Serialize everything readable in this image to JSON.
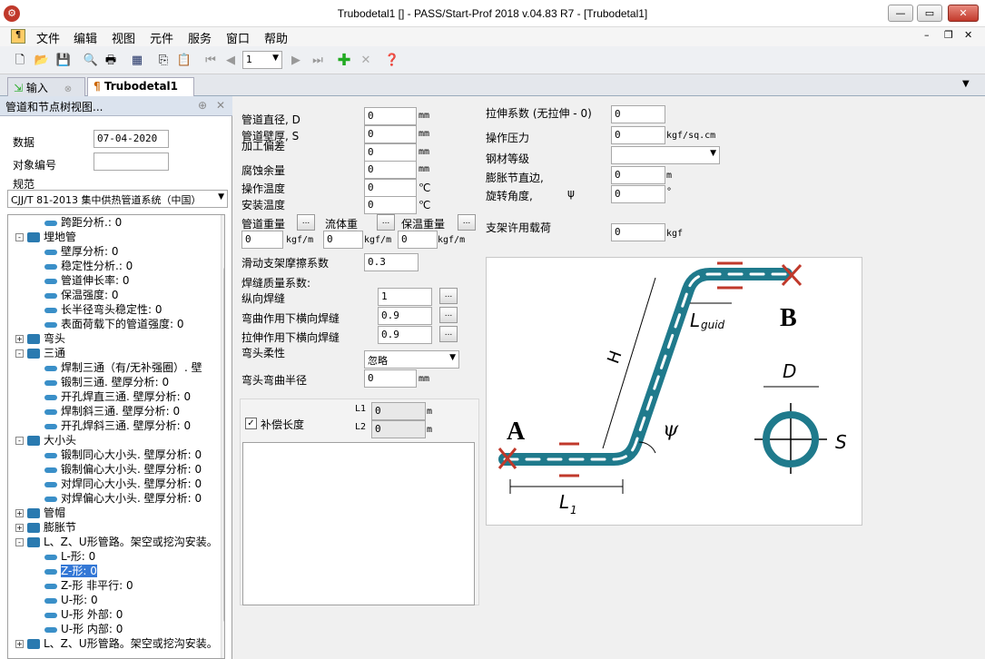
{
  "window": {
    "title": "Trubodetal1 [] - PASS/Start-Prof 2018 v.04.83 R7 - [Trubodetal1]"
  },
  "menu": [
    "文件",
    "编辑",
    "视图",
    "元件",
    "服务",
    "窗口",
    "帮助"
  ],
  "toolbar": {
    "page_value": "1"
  },
  "tabs": [
    {
      "label": "输入"
    },
    {
      "label": "Trubodetal1"
    }
  ],
  "left": {
    "panel_title": "管道和节点树视图...",
    "date_label": "数据",
    "date_value": "07-04-2020",
    "object_label": "对象编号",
    "object_value": "",
    "norm_label": "规范",
    "norm_value": "CJJ/T 81-2013 集中供热管道系统（中国）"
  },
  "tree": [
    {
      "label": "跨距分析.: 0",
      "indent": 2
    },
    {
      "label": "埋地管",
      "indent": 1,
      "exp": "-"
    },
    {
      "label": "壁厚分析: 0",
      "indent": 2
    },
    {
      "label": "稳定性分析.: 0",
      "indent": 2
    },
    {
      "label": "管道伸长率: 0",
      "indent": 2
    },
    {
      "label": "保温强度: 0",
      "indent": 2
    },
    {
      "label": "长半径弯头稳定性: 0",
      "indent": 2
    },
    {
      "label": "表面荷载下的管道强度: 0",
      "indent": 2
    },
    {
      "label": "弯头",
      "indent": 1,
      "exp": "+"
    },
    {
      "label": "三通",
      "indent": 1,
      "exp": "-"
    },
    {
      "label": "焊制三通（有/无补强圈）. 壁",
      "indent": 2
    },
    {
      "label": "锻制三通. 壁厚分析: 0",
      "indent": 2
    },
    {
      "label": "开孔焊直三通. 壁厚分析: 0",
      "indent": 2
    },
    {
      "label": "焊制斜三通. 壁厚分析: 0",
      "indent": 2
    },
    {
      "label": "开孔焊斜三通. 壁厚分析: 0",
      "indent": 2
    },
    {
      "label": "大小头",
      "indent": 1,
      "exp": "-"
    },
    {
      "label": "锻制同心大小头. 壁厚分析: 0",
      "indent": 2
    },
    {
      "label": "锻制偏心大小头. 壁厚分析: 0",
      "indent": 2
    },
    {
      "label": "对焊同心大小头. 壁厚分析: 0",
      "indent": 2
    },
    {
      "label": "对焊偏心大小头. 壁厚分析: 0",
      "indent": 2
    },
    {
      "label": "管帽",
      "indent": 1,
      "exp": "+"
    },
    {
      "label": "膨胀节",
      "indent": 1,
      "exp": "+"
    },
    {
      "label": "L、Z、U形管路。架空或挖沟安装。",
      "indent": 1,
      "exp": "-"
    },
    {
      "label": "L-形: 0",
      "indent": 2
    },
    {
      "label": "Z-形: 0",
      "indent": 2,
      "selected": true
    },
    {
      "label": "Z-形 非平行: 0",
      "indent": 2
    },
    {
      "label": "U-形: 0",
      "indent": 2
    },
    {
      "label": "U-形 外部: 0",
      "indent": 2
    },
    {
      "label": "U-形 内部: 0",
      "indent": 2
    },
    {
      "label": "L、Z、U形管路。架空或挖沟安装。",
      "indent": 1,
      "exp": "+"
    }
  ],
  "form": {
    "diameter": {
      "label": "管道直径, D",
      "value": "0",
      "unit": "mm"
    },
    "wall": {
      "label": "管道壁厚, S",
      "value": "0",
      "unit": "mm"
    },
    "tol": {
      "label": "加工偏差",
      "value": "0",
      "unit": "mm"
    },
    "corr": {
      "label": "腐蚀余量",
      "value": "0",
      "unit": "mm"
    },
    "optemp": {
      "label": "操作温度",
      "value": "0",
      "unit": "℃"
    },
    "insttemp": {
      "label": "安装温度",
      "value": "0",
      "unit": "℃"
    },
    "pipe_w": {
      "label": "管道重量",
      "value": "0",
      "unit": "kgf/m"
    },
    "fluid_w": {
      "label": "流体重",
      "value": "0",
      "unit": "kgf/m"
    },
    "ins_w": {
      "label": "保温重量",
      "value": "0",
      "unit": "kgf/m"
    },
    "friction": {
      "label": "滑动支架摩擦系数",
      "value": "0.3"
    },
    "weld_title": "焊缝质量系数:",
    "weld_long": {
      "label": "纵向焊缝",
      "value": "1"
    },
    "weld_bend": {
      "label": "弯曲作用下横向焊缝",
      "value": "0.9"
    },
    "weld_tens": {
      "label": "拉伸作用下横向焊缝",
      "value": "0.9"
    },
    "flex": {
      "label": "弯头柔性",
      "value": "忽略"
    },
    "radius": {
      "label": "弯头弯曲半径",
      "value": "0",
      "unit": "mm"
    },
    "comp": {
      "label": "补偿长度",
      "checked": true
    },
    "L1": {
      "label": "L1",
      "value": "0",
      "unit": "m"
    },
    "L2": {
      "label": "L2",
      "value": "0",
      "unit": "m"
    },
    "stretch": {
      "label": "拉伸系数 (无拉伸 - 0)",
      "value": "0"
    },
    "pressure": {
      "label": "操作压力",
      "value": "0",
      "unit": "kgf/sq.cm"
    },
    "steel": {
      "label": "钢材等级",
      "value": ""
    },
    "joint_dia": {
      "label": "膨胀节直边,",
      "value": "0",
      "unit": "m"
    },
    "rot": {
      "label": "旋转角度,",
      "sym": "ψ",
      "value": "0",
      "unit": "°"
    },
    "support": {
      "label": "支架许用载荷",
      "value": "0",
      "unit": "kgf"
    }
  },
  "diagram": {
    "A": "A",
    "B": "B",
    "H": "H",
    "L1": "L",
    "L1sub": "1",
    "Lguid": "L",
    "Lguidsub": "guid",
    "psi": "ψ",
    "D": "D",
    "S": "S"
  }
}
